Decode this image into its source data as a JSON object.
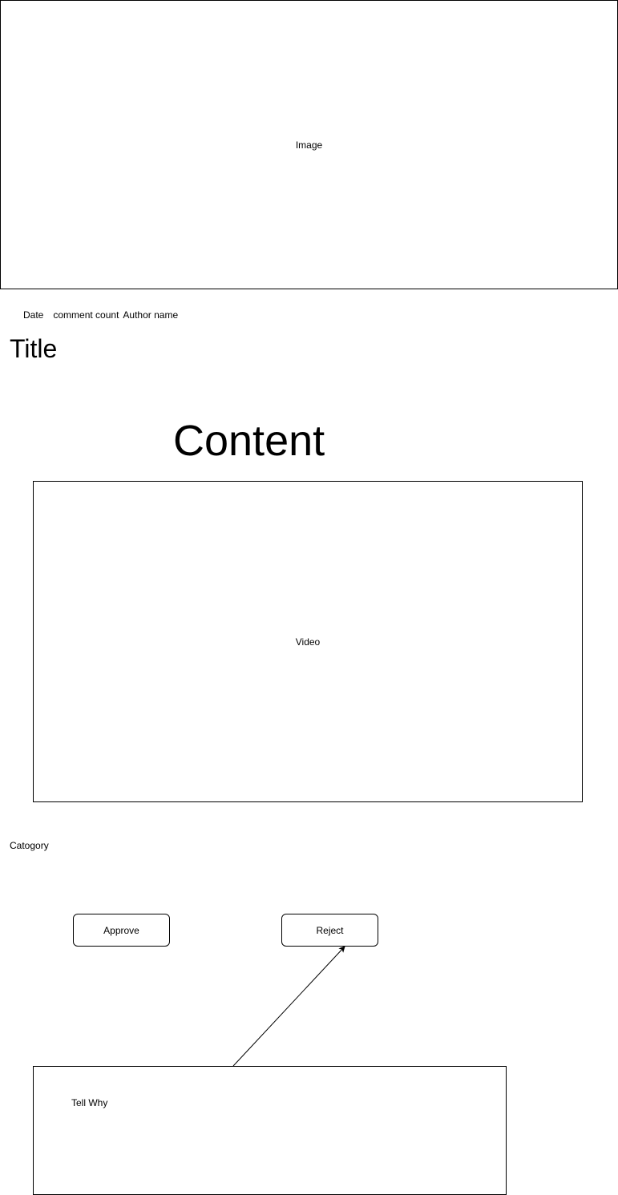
{
  "image_placeholder": {
    "label": "Image"
  },
  "meta": {
    "date": "Date",
    "comment_count": "comment count",
    "author": "Author name"
  },
  "title": "Title",
  "content_heading": "Content",
  "video_placeholder": {
    "label": "Video"
  },
  "category": "Catogory",
  "actions": {
    "approve_label": "Approve",
    "reject_label": "Reject"
  },
  "reject_reason": {
    "label": "Tell Why"
  },
  "colors": {
    "stroke": "#000000",
    "background": "#ffffff"
  }
}
